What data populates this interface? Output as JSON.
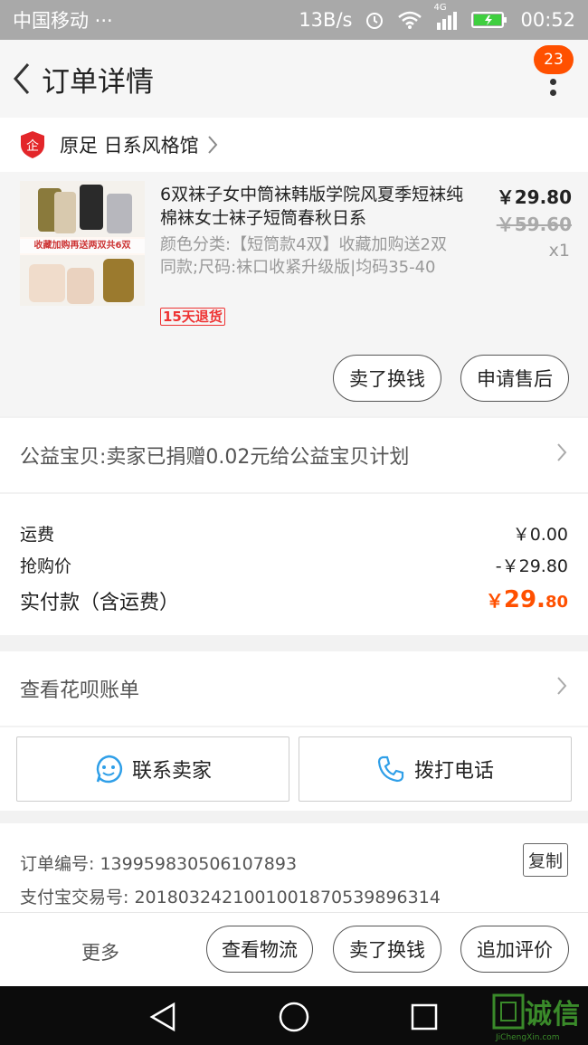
{
  "status_bar": {
    "carrier": "中国移动 ···",
    "net_speed": "13B/s",
    "network": "4G",
    "time": "00:52"
  },
  "nav": {
    "title": "订单详情",
    "badge": "23"
  },
  "shop": {
    "name": "原足 日系风格馆",
    "icon_char": "企"
  },
  "product": {
    "title": "6双袜子女中筒袜韩版学院风夏季短袜纯棉袜女士袜子短筒春秋日系",
    "sku": "颜色分类:【短筒款4双】收藏加购送2双同款;尺码:袜口收紧升级版|均码35-40",
    "tag": "15天退货",
    "price": "￥29.80",
    "original_price": "￥59.60",
    "qty": "x1",
    "thumb_banner": "收藏加购再送两双共6双",
    "btn_sell": "卖了换钱",
    "btn_aftersale": "申请售后"
  },
  "charity": {
    "text": "公益宝贝:卖家已捐赠0.02元给公益宝贝计划"
  },
  "fees": {
    "shipping_label": "运费",
    "shipping_value": "￥0.00",
    "flash_label": "抢购价",
    "flash_value": "-￥29.80",
    "total_label": "实付款（含运费）",
    "total_symbol": "￥",
    "total_int": "29.",
    "total_dec": "80"
  },
  "huabei": {
    "text": "查看花呗账单"
  },
  "contact": {
    "seller": "联系卖家",
    "phone": "拨打电话"
  },
  "order_info": {
    "order_no": "订单编号: 1399598305061078​93",
    "alipay_no": "支付宝交易号: 2018032421001001870539896314",
    "copy": "复制"
  },
  "bottom": {
    "more": "更多",
    "logistics": "查看物流",
    "sell": "卖了换钱",
    "review": "追加评价"
  },
  "watermark": {
    "text": "诚信",
    "sub": "JiChengXin.com"
  },
  "colors": {
    "accent": "#ff5000",
    "status_bar": "#a9a9a9",
    "contact_icon": "#2f9fe8"
  }
}
